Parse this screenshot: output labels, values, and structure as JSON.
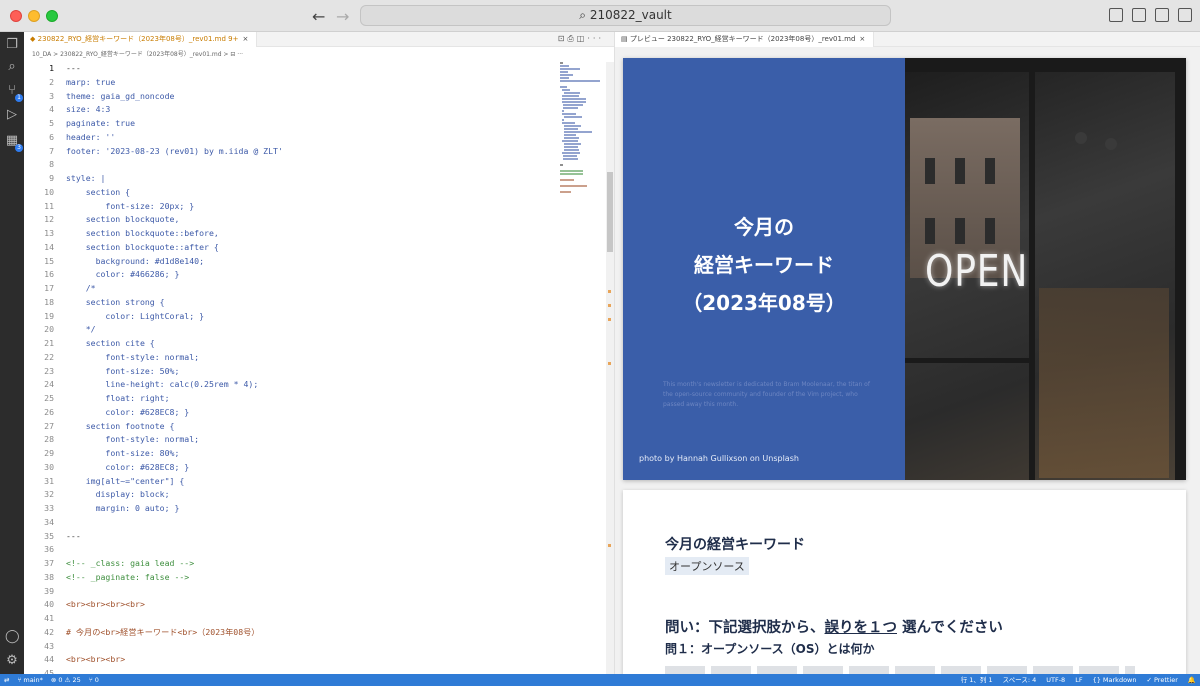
{
  "window": {
    "search_text": "210822_vault"
  },
  "editor": {
    "tab_label": "230822_RYO_経営キーワード（2023年08号）_rev01.md 9+",
    "tab_close": "×",
    "breadcrumb": "10_DA  >  230822_RYO_経営キーワード（2023年08号）_rev01.md  >  ⊟ ···",
    "lines": [
      {
        "n": "1",
        "t": "---",
        "color": "#333333"
      },
      {
        "n": "2",
        "t": "marp: true",
        "color": "#3d5aa8"
      },
      {
        "n": "3",
        "t": "theme: gaia_gd_noncode",
        "color": "#3d5aa8"
      },
      {
        "n": "4",
        "t": "size: 4:3",
        "color": "#3d5aa8"
      },
      {
        "n": "5",
        "t": "paginate: true",
        "color": "#3d5aa8"
      },
      {
        "n": "6",
        "t": "header: ''",
        "color": "#3d5aa8"
      },
      {
        "n": "7",
        "t": "footer: '2023-08-23 (rev01) by m.iida @ ZLT'",
        "color": "#3d5aa8"
      },
      {
        "n": "8",
        "t": "",
        "color": "#333333"
      },
      {
        "n": "9",
        "t": "style: |",
        "color": "#3d5aa8"
      },
      {
        "n": "10",
        "t": "    section {",
        "color": "#3d5aa8"
      },
      {
        "n": "11",
        "t": "        font-size: 20px; }",
        "color": "#3d5aa8"
      },
      {
        "n": "12",
        "t": "    section blockquote,",
        "color": "#3d5aa8"
      },
      {
        "n": "13",
        "t": "    section blockquote::before,",
        "color": "#3d5aa8"
      },
      {
        "n": "14",
        "t": "    section blockquote::after {",
        "color": "#3d5aa8"
      },
      {
        "n": "15",
        "t": "      background: #d1d8e140;",
        "color": "#3d5aa8"
      },
      {
        "n": "16",
        "t": "      color: #466286; }",
        "color": "#3d5aa8"
      },
      {
        "n": "17",
        "t": "    /*",
        "color": "#3d5aa8"
      },
      {
        "n": "18",
        "t": "    section strong {",
        "color": "#3d5aa8"
      },
      {
        "n": "19",
        "t": "        color: LightCoral; }",
        "color": "#3d5aa8"
      },
      {
        "n": "20",
        "t": "    */",
        "color": "#3d5aa8"
      },
      {
        "n": "21",
        "t": "    section cite {",
        "color": "#3d5aa8"
      },
      {
        "n": "22",
        "t": "        font-style: normal;",
        "color": "#3d5aa8"
      },
      {
        "n": "23",
        "t": "        font-size: 50%;",
        "color": "#3d5aa8"
      },
      {
        "n": "24",
        "t": "        line-height: calc(0.25rem * 4);",
        "color": "#3d5aa8"
      },
      {
        "n": "25",
        "t": "        float: right;",
        "color": "#3d5aa8"
      },
      {
        "n": "26",
        "t": "        color: #628EC8; }",
        "color": "#3d5aa8"
      },
      {
        "n": "27",
        "t": "    section footnote {",
        "color": "#3d5aa8"
      },
      {
        "n": "28",
        "t": "        font-style: normal;",
        "color": "#3d5aa8"
      },
      {
        "n": "29",
        "t": "        font-size: 80%;",
        "color": "#3d5aa8"
      },
      {
        "n": "30",
        "t": "        color: #628EC8; }",
        "color": "#3d5aa8"
      },
      {
        "n": "31",
        "t": "    img[alt~=\"center\"] {",
        "color": "#3d5aa8"
      },
      {
        "n": "32",
        "t": "      display: block;",
        "color": "#3d5aa8"
      },
      {
        "n": "33",
        "t": "      margin: 0 auto; }",
        "color": "#3d5aa8"
      },
      {
        "n": "34",
        "t": "",
        "color": "#333333"
      },
      {
        "n": "35",
        "t": "---",
        "color": "#333333"
      },
      {
        "n": "36",
        "t": "",
        "color": "#333333"
      },
      {
        "n": "37",
        "t": "<!-- _class: gaia lead -->",
        "color": "#3f8f3f"
      },
      {
        "n": "38",
        "t": "<!-- _paginate: false -->",
        "color": "#3f8f3f"
      },
      {
        "n": "39",
        "t": "",
        "color": "#333333"
      },
      {
        "n": "40",
        "t": "<br><br><br><br>",
        "color": "#a0522d"
      },
      {
        "n": "41",
        "t": "",
        "color": "#333333"
      },
      {
        "n": "42",
        "t": "# 今月の<br>経営キーワード<br>（2023年08号）",
        "color": "#a0522d"
      },
      {
        "n": "43",
        "t": "",
        "color": "#333333"
      },
      {
        "n": "44",
        "t": "<br><br><br>",
        "color": "#a0522d"
      },
      {
        "n": "45",
        "t": "",
        "color": "#333333"
      }
    ]
  },
  "preview": {
    "tab_label": "プレビュー 230822_RYO_経営キーワード（2023年08号）_rev01.md",
    "tab_close": "×",
    "slide1": {
      "title_line1": "今月の",
      "title_line2": "経営キーワード",
      "title_line3": "（2023年08号）",
      "small_text": "This month's newsletter is dedicated to Bram Moolenaar, the titan of the open-source community and founder of the Vim project, who passed away this month.",
      "photo_credit": "photo by Hannah Gullixson on Unsplash",
      "sign_text": "OPEN",
      "blue": "#3a5ea9"
    },
    "slide2": {
      "heading": "今月の経営キーワード",
      "tag": "オープンソース",
      "question_prefix": "問い：下記選択肢から、",
      "question_underlined": "誤りを１つ",
      "question_suffix": " 選んでください",
      "sub": "問１：オープンソース（OS）とは何か"
    }
  },
  "statusbar": {
    "branch": "main*",
    "problems": "⊗ 0 ⚠ 25",
    "ports": "⑂ 0",
    "position": "行 1、列 1",
    "spaces": "スペース: 4",
    "encoding": "UTF-8",
    "eol": "LF",
    "language": "{} Markdown",
    "formatter": "✓ Prettier",
    "bell": "🔔",
    "color": "#2f7bd6"
  }
}
